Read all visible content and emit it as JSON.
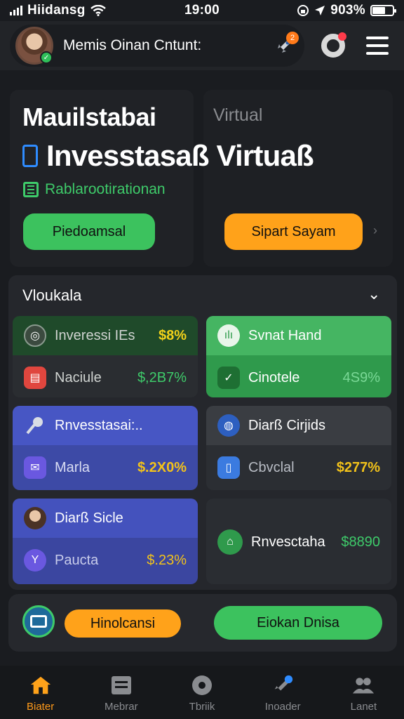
{
  "status_bar": {
    "carrier": "Hiidansg",
    "time": "19:00",
    "battery": "903%"
  },
  "header": {
    "name": "Memis Oinan Cntunt:",
    "notif_badge": "2"
  },
  "hero": {
    "title": "Mauilstabai",
    "virtual_label": "Virtual",
    "big_title": "Invesstasaß Virtuaß",
    "subtitle": "Rablarootirationan",
    "primary_button": "Piedoamsal",
    "secondary_button": "Sipart Sayam"
  },
  "section": {
    "title": "Vloukala",
    "cards": [
      {
        "top_label": "Inveressi IEs",
        "top_value": "$8%",
        "bot_label": "Naciule",
        "bot_value": "$,2B7%"
      },
      {
        "top_label": "Svnat Hand",
        "bot_label": "Cinotele",
        "bot_value": "4S9%"
      },
      {
        "top_label": "Rnvesstasai:..",
        "bot_label": "Marla",
        "bot_value": "$.2X0%"
      },
      {
        "top_label": "Diarß Cirjids",
        "bot_label": "Cbvclal",
        "bot_value": "$277%"
      },
      {
        "top_label": "Diarß Sicle",
        "bot_label": "Paucta",
        "bot_value": "$.23%"
      },
      {
        "top_label": "Rnvesctaha",
        "top_value": "$8890"
      }
    ]
  },
  "actions": {
    "button_orange": "Hinolcansi",
    "button_green": "Eiokan Dnisa"
  },
  "bottom_nav": [
    {
      "label": "Biater",
      "active": true
    },
    {
      "label": "Mebrar"
    },
    {
      "label": "Tbriik"
    },
    {
      "label": "Inoader"
    },
    {
      "label": "Lanet"
    }
  ],
  "colors": {
    "accent_orange": "#ffa21a",
    "accent_green": "#3cc25e",
    "accent_blue": "#4756c4",
    "bg": "#1a1c20"
  }
}
